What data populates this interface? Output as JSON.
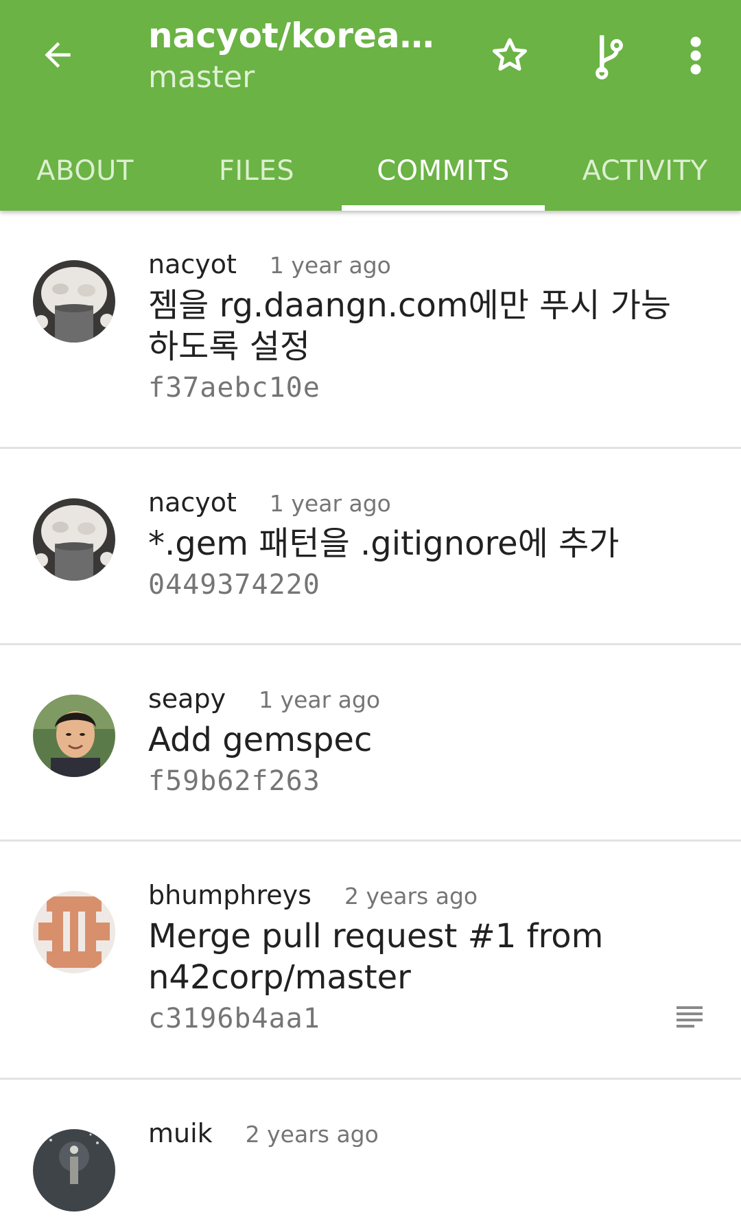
{
  "appbar": {
    "title": "nacyot/korean…",
    "subtitle": "master",
    "color": "#6ab344",
    "icons": {
      "back": "arrow-back-icon",
      "star": "star-outline-icon",
      "branch": "git-branch-icon",
      "more": "more-vert-icon"
    }
  },
  "tabs": [
    {
      "label": "ABOUT",
      "active": false
    },
    {
      "label": "FILES",
      "active": false
    },
    {
      "label": "COMMITS",
      "active": true
    },
    {
      "label": "ACTIVITY",
      "active": false
    }
  ],
  "commits": [
    {
      "author": "nacyot",
      "time": "1 year ago",
      "message": "젬을 rg.daangn.com에만 푸시 가능\n하도록 설정",
      "sha": "f37aebc10e",
      "avatar": "cat-avatar"
    },
    {
      "author": "nacyot",
      "time": "1 year ago",
      "message": "*.gem 패턴을 .gitignore에 추가",
      "sha": "0449374220",
      "avatar": "cat-avatar"
    },
    {
      "author": "seapy",
      "time": "1 year ago",
      "message": "Add gemspec",
      "sha": "f59b62f263",
      "avatar": "person-avatar"
    },
    {
      "author": "bhumphreys",
      "time": "2 years ago",
      "message": "Merge pull request #1 from\nn42corp/master",
      "sha": "c3196b4aa1",
      "avatar": "identicon-avatar",
      "has_description": true,
      "description_icon": "subject-lines-icon"
    },
    {
      "author": "muik",
      "time": "2 years ago",
      "message": "",
      "sha": "",
      "avatar": "dark-photo-avatar"
    }
  ]
}
